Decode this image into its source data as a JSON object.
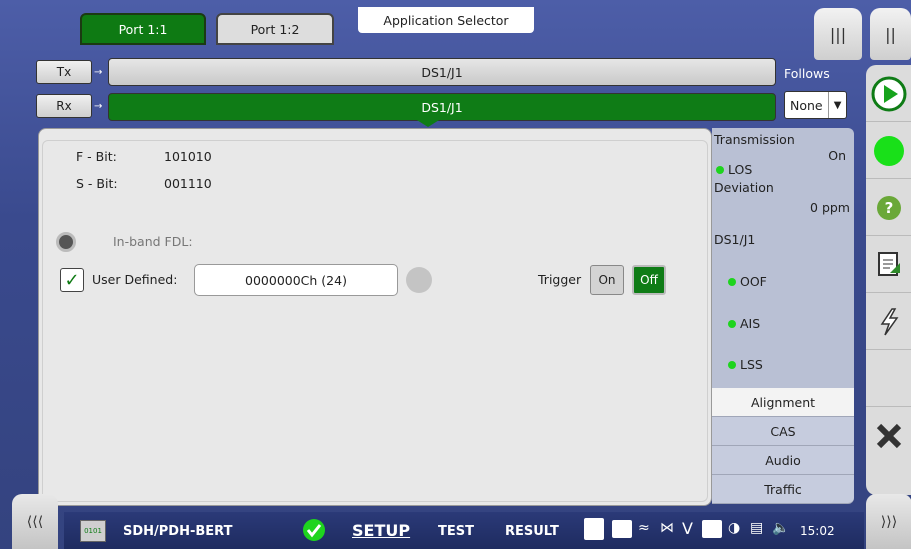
{
  "tabs": {
    "port1": "Port 1:1",
    "port2": "Port 1:2",
    "app_selector": "Application Selector"
  },
  "signal": {
    "tx_label": "Tx",
    "rx_label": "Rx",
    "tx_value": "DS1/J1",
    "rx_value": "DS1/J1",
    "follows_label": "Follows",
    "follows_value": "None"
  },
  "main": {
    "f_bit_label": "F - Bit:",
    "f_bit_value": "101010",
    "s_bit_label": "S - Bit:",
    "s_bit_value": "001110",
    "inband_label": "In-band FDL:",
    "user_defined_label": "User Defined:",
    "user_defined_value": "0000000Ch (24)",
    "trigger_label": "Trigger",
    "trigger_on": "On",
    "trigger_off": "Off"
  },
  "status": {
    "transmission_label": "Transmission",
    "transmission_value": "On",
    "los": "LOS",
    "deviation_label": "Deviation",
    "deviation_value": "0 ppm",
    "ds1_label": "DS1/J1",
    "oof": "OOF",
    "ais": "AIS",
    "lss": "LSS"
  },
  "side_tabs": [
    "Alignment",
    "CAS",
    "Audio",
    "Traffic"
  ],
  "bottom": {
    "app_name": "SDH/PDH-BERT",
    "setup": "SETUP",
    "test": "TEST",
    "result": "RESULT",
    "time": "15:02"
  },
  "colors": {
    "active_green": "#0f7c16",
    "led_green": "#1ed41e",
    "frame_blue": "#3b4a86"
  }
}
